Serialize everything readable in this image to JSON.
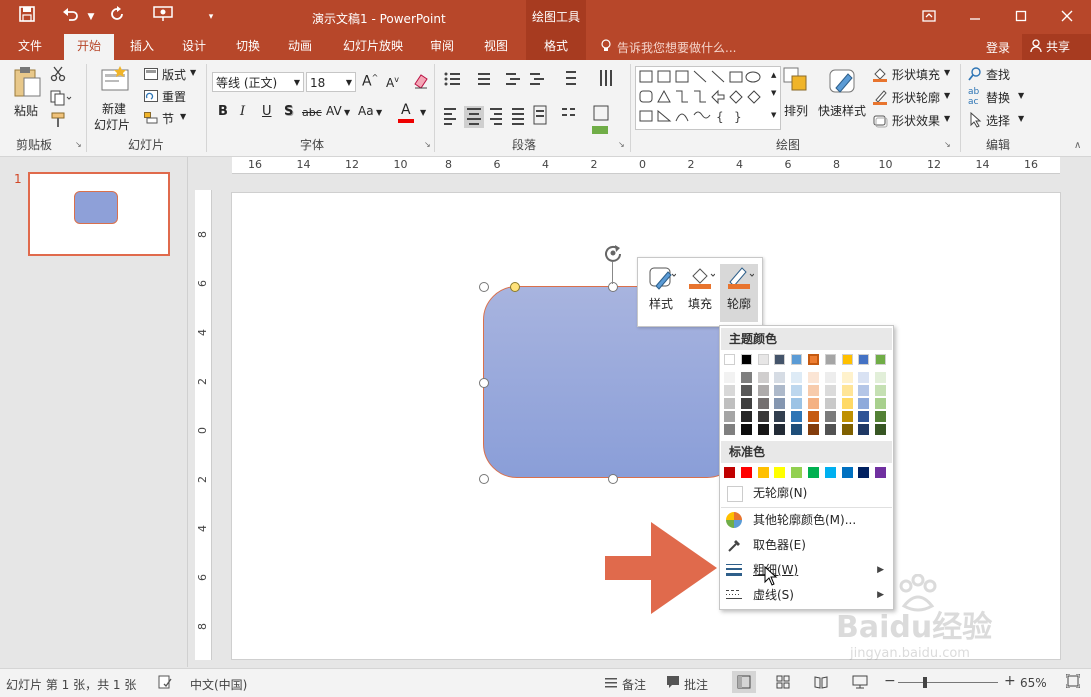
{
  "window": {
    "title": "演示文稿1 - PowerPoint",
    "context_group": "绘图工具"
  },
  "tabs": [
    "文件",
    "开始",
    "插入",
    "设计",
    "切换",
    "动画",
    "幻灯片放映",
    "审阅",
    "视图",
    "格式"
  ],
  "tell_me": "告诉我您想要做什么...",
  "account": {
    "login": "登录",
    "share": "共享"
  },
  "ribbon": {
    "clipboard": {
      "paste": "粘贴",
      "label": "剪贴板"
    },
    "slides": {
      "new_slide_1": "新建",
      "new_slide_2": "幻灯片",
      "layout": "版式",
      "reset": "重置",
      "section": "节",
      "label": "幻灯片"
    },
    "font": {
      "name": "等线 (正文)",
      "size": "18",
      "label": "字体",
      "bold": "B",
      "italic": "I",
      "underline": "U",
      "shadow": "S",
      "strike": "abc",
      "spacing": "AV",
      "case": "Aa",
      "color": "A"
    },
    "paragraph": {
      "label": "段落"
    },
    "drawing": {
      "arrange": "排列",
      "quick_styles": "快速样式",
      "fill": "形状填充",
      "outline": "形状轮廓",
      "effects": "形状效果",
      "label": "绘图"
    },
    "editing": {
      "find": "查找",
      "replace": "替换",
      "select": "选择",
      "label": "编辑"
    }
  },
  "slide_panel": {
    "number": "1"
  },
  "ruler_h": [
    "16",
    "14",
    "12",
    "10",
    "8",
    "6",
    "4",
    "2",
    "0",
    "2",
    "4",
    "6",
    "8",
    "10",
    "12",
    "14",
    "16"
  ],
  "ruler_v": [
    "8",
    "6",
    "4",
    "2",
    "0",
    "2",
    "4",
    "6",
    "8"
  ],
  "mini_toolbar": {
    "style": "样式",
    "fill": "填充",
    "outline": "轮廓"
  },
  "color_menu": {
    "theme_header": "主题颜色",
    "standard_header": "标准色",
    "no_outline": "无轮廓(N)",
    "more_colors": "其他轮廓颜色(M)...",
    "eyedropper": "取色器(E)",
    "weight": "粗细(W)",
    "dashes": "虚线(S)",
    "theme_top": [
      "#ffffff",
      "#000000",
      "#e7e6e6",
      "#44546a",
      "#5b9bd5",
      "#ed7d31",
      "#a5a5a5",
      "#ffc000",
      "#4472c4",
      "#70ad47"
    ],
    "theme_shades": [
      [
        "#f2f2f2",
        "#7f7f7f",
        "#d0cece",
        "#d6dce4",
        "#deebf6",
        "#fbe5d5",
        "#ededed",
        "#fff2cc",
        "#d9e2f3",
        "#e2efd9"
      ],
      [
        "#d8d8d8",
        "#595959",
        "#aeabab",
        "#adb9ca",
        "#bdd7ee",
        "#f7cbac",
        "#dbdbdb",
        "#ffe598",
        "#b4c6e7",
        "#c5e0b3"
      ],
      [
        "#bfbfbf",
        "#3f3f3f",
        "#757070",
        "#8496b0",
        "#9cc3e5",
        "#f4b183",
        "#c9c9c9",
        "#ffd965",
        "#8eaadb",
        "#a8d08d"
      ],
      [
        "#a5a5a5",
        "#262626",
        "#3a3838",
        "#323f4f",
        "#2e75b5",
        "#c55a11",
        "#7b7b7b",
        "#bf9000",
        "#2f5496",
        "#538135"
      ],
      [
        "#7f7f7f",
        "#0c0c0c",
        "#171616",
        "#222a35",
        "#1e4e79",
        "#833c0b",
        "#525252",
        "#7f6000",
        "#1f3864",
        "#375623"
      ]
    ],
    "standard": [
      "#c00000",
      "#ff0000",
      "#ffc000",
      "#ffff00",
      "#92d050",
      "#00b050",
      "#00b0f0",
      "#0070c0",
      "#002060",
      "#7030a0"
    ]
  },
  "status": {
    "slide_info": "幻灯片 第 1 张，共 1 张",
    "language": "中文(中国)",
    "notes": "备注",
    "comments": "批注",
    "zoom": "65%"
  },
  "watermark": {
    "brand": "Baidu经验",
    "url": "jingyan.baidu.com"
  },
  "colors": {
    "accent": "#b7472a",
    "context_tab": "#a73b20",
    "shape_fill": "#8ea0d8",
    "shape_outline": "#d9704c",
    "arrow": "#e06a4c"
  }
}
